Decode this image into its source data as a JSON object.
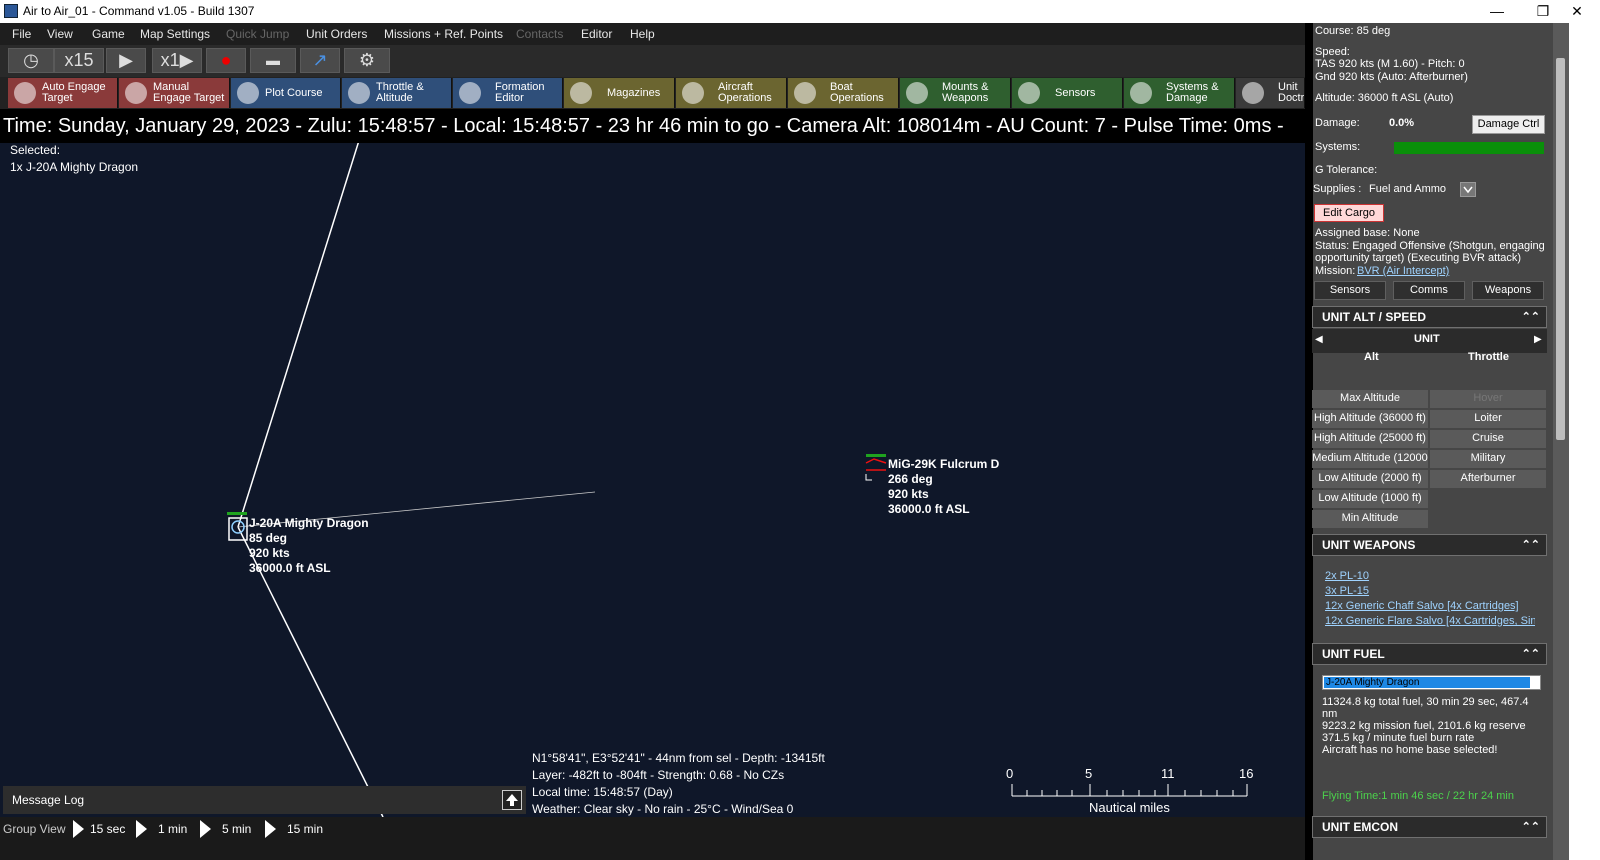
{
  "window": {
    "title": "Air to Air_01 - Command v1.05 - Build 1307",
    "minimize": "—",
    "restore": "❐",
    "close": "✕"
  },
  "menu": [
    "File",
    "View",
    "Game",
    "Map Settings",
    "Quick Jump",
    "Unit Orders",
    "Missions + Ref. Points",
    "Contacts",
    "Editor",
    "Help"
  ],
  "sim": {
    "compression": "x15",
    "speed": "x1"
  },
  "toolbar": [
    {
      "label1": "Auto Engage",
      "label2": "Target",
      "color": "#8a3a3a"
    },
    {
      "label1": "Manual",
      "label2": "Engage Target",
      "color": "#8a3a3a"
    },
    {
      "label1": "Plot Course",
      "label2": "",
      "color": "#2f4f7a"
    },
    {
      "label1": "Throttle &",
      "label2": "Altitude",
      "color": "#2f4f7a"
    },
    {
      "label1": "Formation",
      "label2": "Editor",
      "color": "#2f4f7a"
    },
    {
      "label1": "Magazines",
      "label2": "",
      "color": "#6b6530"
    },
    {
      "label1": "Aircraft",
      "label2": "Operations",
      "color": "#6b6530"
    },
    {
      "label1": "Boat",
      "label2": "Operations",
      "color": "#6b6530"
    },
    {
      "label1": "Mounts &",
      "label2": "Weapons",
      "color": "#2f5f2f"
    },
    {
      "label1": "Sensors",
      "label2": "",
      "color": "#2f5f2f"
    },
    {
      "label1": "Systems &",
      "label2": "Damage",
      "color": "#2f5f2f"
    },
    {
      "label1": "Unit",
      "label2": "Doctr",
      "color": "#3a3a3a"
    }
  ],
  "status_line": "Time: Sunday, January 29, 2023 - Zulu: 15:48:57 - Local: 15:48:57 - 23 hr 46 min to go -  Camera Alt: 108014m  - AU Count: 7 - Pulse Time: 0ms -",
  "selected": {
    "label": "Selected:",
    "unit": "1x J-20A Mighty Dragon"
  },
  "units": {
    "own": {
      "name": "J-20A Mighty Dragon",
      "course": "85 deg",
      "speed": "920 kts",
      "alt": "36000.0 ft ASL"
    },
    "contact": {
      "name": "MiG-29K Fulcrum D",
      "course": "266 deg",
      "speed": "920 kts",
      "alt": "36000.0 ft ASL"
    }
  },
  "cursor_info": {
    "line1": "N1°58'41\", E3°52'41\" - 44nm from sel - Depth: -13415ft",
    "line2": "Layer: -482ft to -804ft - Strength: 0.68 - No CZs",
    "line3": "Local time: 15:48:57 (Day)",
    "line4": "Weather: Clear sky - No rain - 25°C - Wind/Sea 0"
  },
  "scale": {
    "ticks": [
      "0",
      "5",
      "11",
      "16"
    ],
    "unit": "Nautical miles"
  },
  "message_log": "Message Log",
  "bottom": {
    "group_view": "Group View",
    "steps": [
      "15 sec",
      "1 min",
      "5 min",
      "15 min"
    ]
  },
  "panel": {
    "course": "Course: 85 deg",
    "speed_label": "Speed:",
    "tas": "TAS 920 kts (M 1.60) - Pitch: 0",
    "gnd": "Gnd 920 kts (Auto: Afterburner)",
    "altitude": "Altitude: 36000 ft ASL (Auto)",
    "damage_label": "Damage:",
    "damage_value": "0.0%",
    "damage_ctrl": "Damage Ctrl",
    "systems_label": "Systems:",
    "systems_color": "#0a8f0a",
    "g_tolerance": "G Tolerance:",
    "supplies_label": "Supplies :",
    "supplies_value": "Fuel and Ammo",
    "edit_cargo": "Edit Cargo",
    "assigned_base": "Assigned base: None",
    "status1": "Status: Engaged Offensive (Shotgun, engaging",
    "status2": "opportunity target) (Executing BVR attack)",
    "mission_label": "Mission:",
    "mission_link": "BVR (Air Intercept)",
    "tabs": [
      "Sensors",
      "Comms",
      "Weapons"
    ],
    "alt_speed": {
      "title": "UNIT ALT / SPEED",
      "header": "UNIT",
      "col_alt": "Alt",
      "col_throttle": "Throttle",
      "alt_buttons": [
        "Max Altitude",
        "High Altitude (36000 ft)",
        "High Altitude (25000 ft)",
        "Medium Altitude (12000",
        "Low Altitude (2000 ft)",
        "Low Altitude (1000 ft)",
        "Min Altitude"
      ],
      "throttle_buttons": [
        "Hover",
        "Loiter",
        "Cruise",
        "Military",
        "Afterburner"
      ]
    },
    "weapons": {
      "title": "UNIT WEAPONS",
      "items": [
        "2x PL-10",
        "3x PL-15",
        "12x Generic Chaff Salvo [4x Cartridges]",
        "12x Generic Flare Salvo [4x Cartridges, Sin"
      ]
    },
    "fuel": {
      "title": "UNIT FUEL",
      "bar_label": "J-20A Mighty Dragon",
      "bar_fill": 0.96,
      "line1": "11324.8 kg total fuel, 30 min 29 sec, 467.4",
      "line2": "nm",
      "line3": "9223.2 kg mission fuel, 2101.6 kg reserve",
      "line4": "371.5 kg / minute fuel burn rate",
      "line5": "Aircraft has no home base selected!",
      "flying_time": "Flying Time:1 min 46 sec / 22 hr 24 min"
    },
    "emcon": {
      "title": "UNIT EMCON"
    }
  }
}
